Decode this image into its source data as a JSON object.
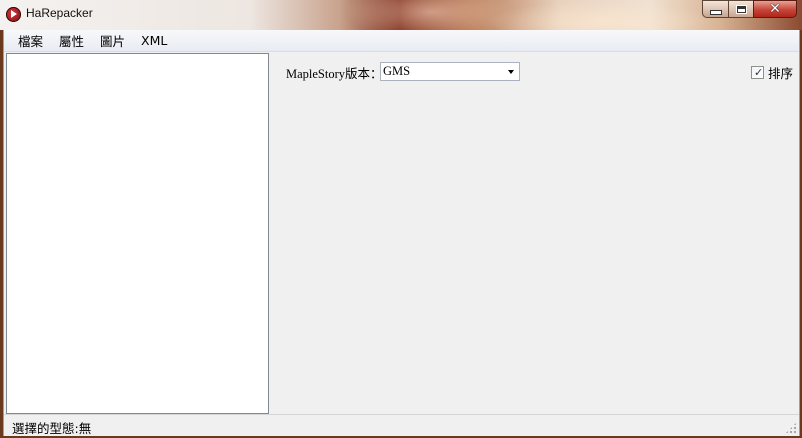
{
  "window": {
    "title": "HaRepacker",
    "icon": "harepacker-app-icon",
    "buttons": {
      "minimize": "minimize-icon",
      "maximize": "maximize-icon",
      "close": "✕"
    }
  },
  "menu": {
    "items": [
      {
        "label": "檔案"
      },
      {
        "label": "屬性"
      },
      {
        "label": "圖片"
      },
      {
        "label": "XML"
      }
    ]
  },
  "settings": {
    "version_label": "MapleStory版本：",
    "version_value": "GMS",
    "sort_label": "排序",
    "sort_checked": true
  },
  "status": {
    "text": "選擇的型態:無"
  }
}
